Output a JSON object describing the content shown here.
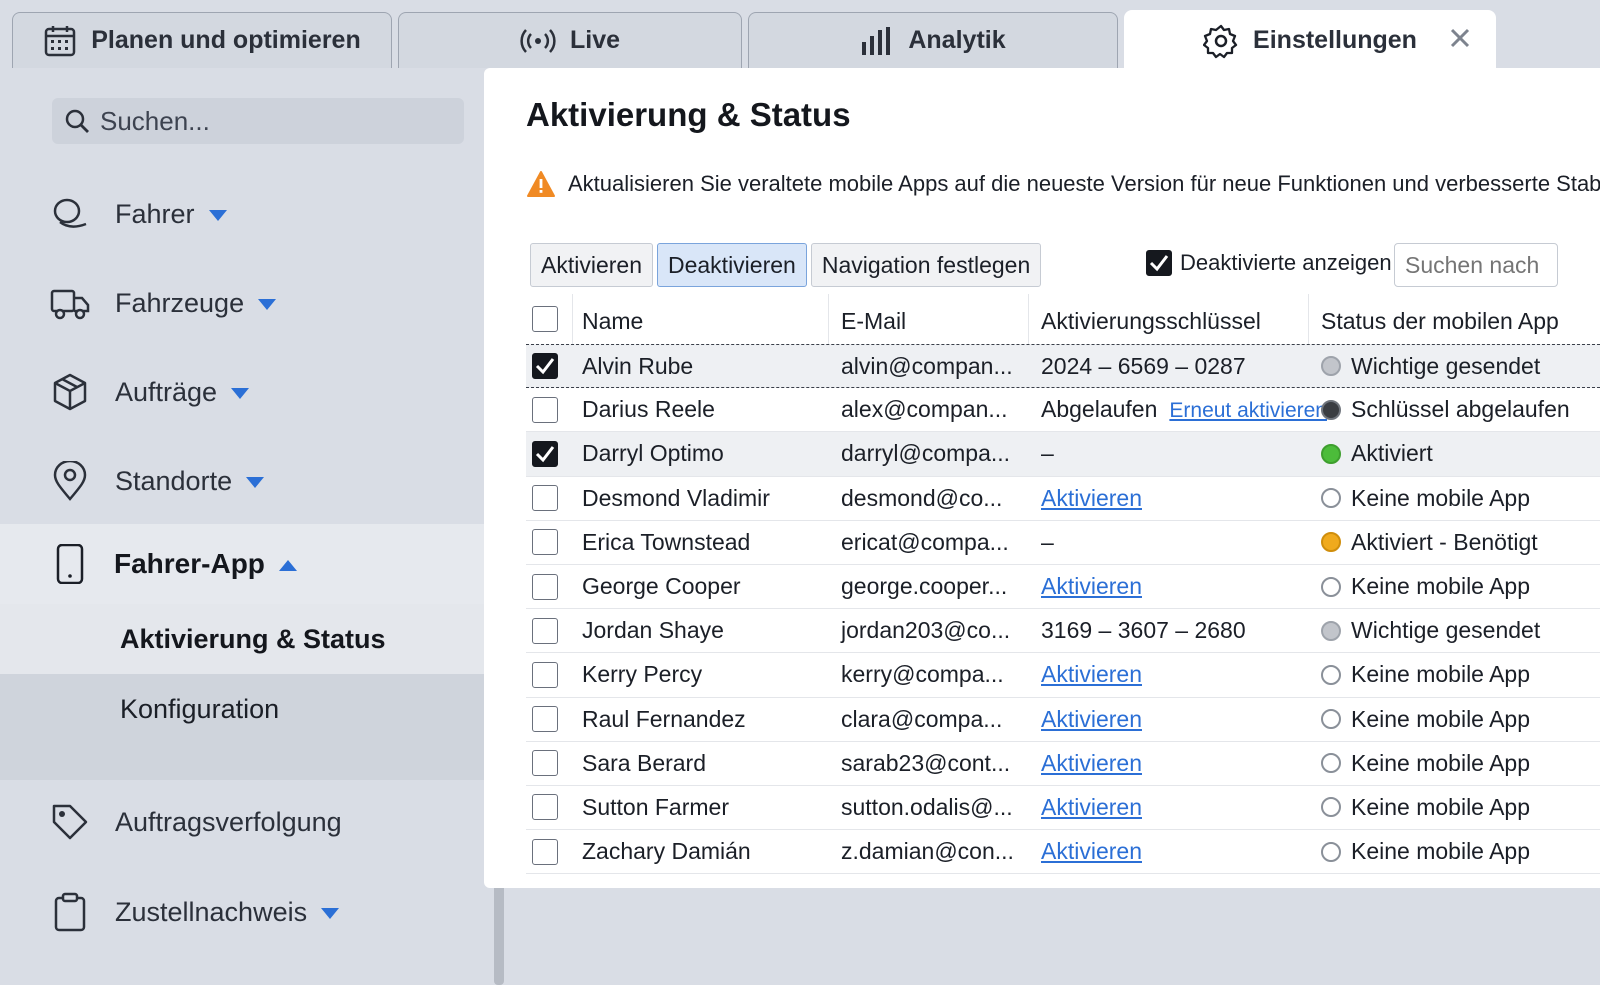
{
  "tabs": [
    {
      "label": "Planen und optimieren",
      "icon": "calendar-icon"
    },
    {
      "label": "Live",
      "icon": "broadcast-icon"
    },
    {
      "label": "Analytik",
      "icon": "bar-chart-icon"
    },
    {
      "label": "Einstellungen",
      "icon": "gear-icon",
      "active": true
    }
  ],
  "sidebar": {
    "search_placeholder": "Suchen...",
    "items": [
      {
        "label": "Fahrer",
        "icon": "driver-icon"
      },
      {
        "label": "Fahrzeuge",
        "icon": "truck-icon"
      },
      {
        "label": "Aufträge",
        "icon": "package-icon"
      },
      {
        "label": "Standorte",
        "icon": "location-pin-icon"
      },
      {
        "label": "Fahrer-App",
        "icon": "phone-icon",
        "expanded": true
      },
      {
        "label": "Auftragsverfolgung",
        "icon": "tag-icon"
      },
      {
        "label": "Zustellnachweis",
        "icon": "clipboard-icon"
      }
    ],
    "subitems": [
      {
        "label": "Aktivierung & Status",
        "active": true
      },
      {
        "label": "Konfiguration"
      }
    ]
  },
  "main": {
    "title": "Aktivierung & Status",
    "warning": "Aktualisieren Sie veraltete mobile Apps auf die neueste Version für neue Funktionen und verbesserte Stabilität",
    "toolbar": {
      "activate": "Aktivieren",
      "deactivate": "Deaktivieren",
      "set_navigation": "Navigation festlegen",
      "show_deactivated": "Deaktivierte anzeigen",
      "search_placeholder": "Suchen nach"
    },
    "columns": [
      "Name",
      "E-Mail",
      "Aktivierungsschlüssel",
      "Status der mobilen App"
    ],
    "rows": [
      {
        "checked": true,
        "name": "Alvin Rube",
        "email": "alvin@compan...",
        "key": "2024 – 6569 – 0287",
        "status": "Wichtige gesendet",
        "status_color": "grey"
      },
      {
        "checked": false,
        "name": "Darius Reele",
        "email": "alex@compan...",
        "key": "Abgelaufen",
        "key_link": "Erneut aktivieren",
        "status": "Schlüssel abgelaufen",
        "status_color": "dark"
      },
      {
        "checked": true,
        "name": "Darryl Optimo",
        "email": "darryl@compa...",
        "key": "–",
        "status": "Aktiviert",
        "status_color": "green"
      },
      {
        "checked": false,
        "name": "Desmond Vladimir",
        "email": "desmond@co...",
        "key_link": "Aktivieren",
        "status": "Keine mobile App",
        "status_color": "empty"
      },
      {
        "checked": false,
        "name": "Erica Townstead",
        "email": "ericat@compa...",
        "key": "–",
        "status": "Aktiviert - Benötigt",
        "status_color": "orange"
      },
      {
        "checked": false,
        "name": "George Cooper",
        "email": "george.cooper...",
        "key_link": "Aktivieren",
        "status": "Keine mobile App",
        "status_color": "empty"
      },
      {
        "checked": false,
        "name": "Jordan Shaye",
        "email": "jordan203@co...",
        "key": "3169 – 3607 – 2680",
        "status": "Wichtige gesendet",
        "status_color": "grey"
      },
      {
        "checked": false,
        "name": "Kerry Percy",
        "email": "kerry@compa...",
        "key_link": "Aktivieren",
        "status": "Keine mobile App",
        "status_color": "empty"
      },
      {
        "checked": false,
        "name": "Raul Fernandez",
        "email": "clara@compa...",
        "key_link": "Aktivieren",
        "status": "Keine mobile App",
        "status_color": "empty"
      },
      {
        "checked": false,
        "name": "Sara Berard",
        "email": "sarab23@cont...",
        "key_link": "Aktivieren",
        "status": "Keine mobile App",
        "status_color": "empty"
      },
      {
        "checked": false,
        "name": "Sutton Farmer",
        "email": "sutton.odalis@...",
        "key_link": "Aktivieren",
        "status": "Keine mobile App",
        "status_color": "empty"
      },
      {
        "checked": false,
        "name": "Zachary Damián",
        "email": "z.damian@con...",
        "key_link": "Aktivieren",
        "status": "Keine mobile App",
        "status_color": "empty"
      }
    ]
  }
}
